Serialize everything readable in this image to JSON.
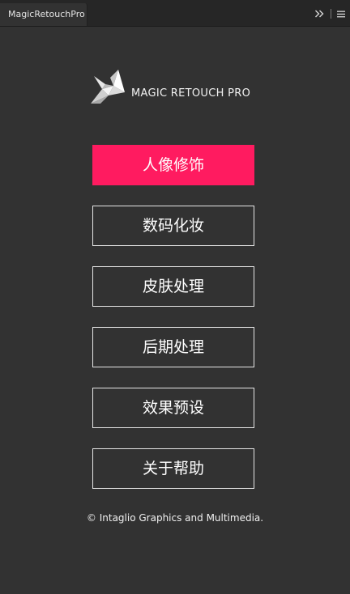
{
  "window": {
    "tab_title": "MagicRetouchPro",
    "collapse_glyph": "»",
    "menu_icon": "hamburger-menu-icon"
  },
  "brand": {
    "logo_icon": "origami-bird-logo",
    "name": "MAGIC RETOUCH PRO"
  },
  "menu": {
    "items": [
      {
        "label": "人像修饰"
      },
      {
        "label": "数码化妆"
      },
      {
        "label": "皮肤处理"
      },
      {
        "label": "后期处理"
      },
      {
        "label": "效果预设"
      },
      {
        "label": "关于帮助"
      }
    ]
  },
  "footer": {
    "copyright": "© Intaglio Graphics and Multimedia."
  },
  "colors": {
    "background": "#323232",
    "tabbar": "#262626",
    "accent": "#ff1b60",
    "button_border": "#e6e6e6",
    "text": "#ffffff"
  }
}
